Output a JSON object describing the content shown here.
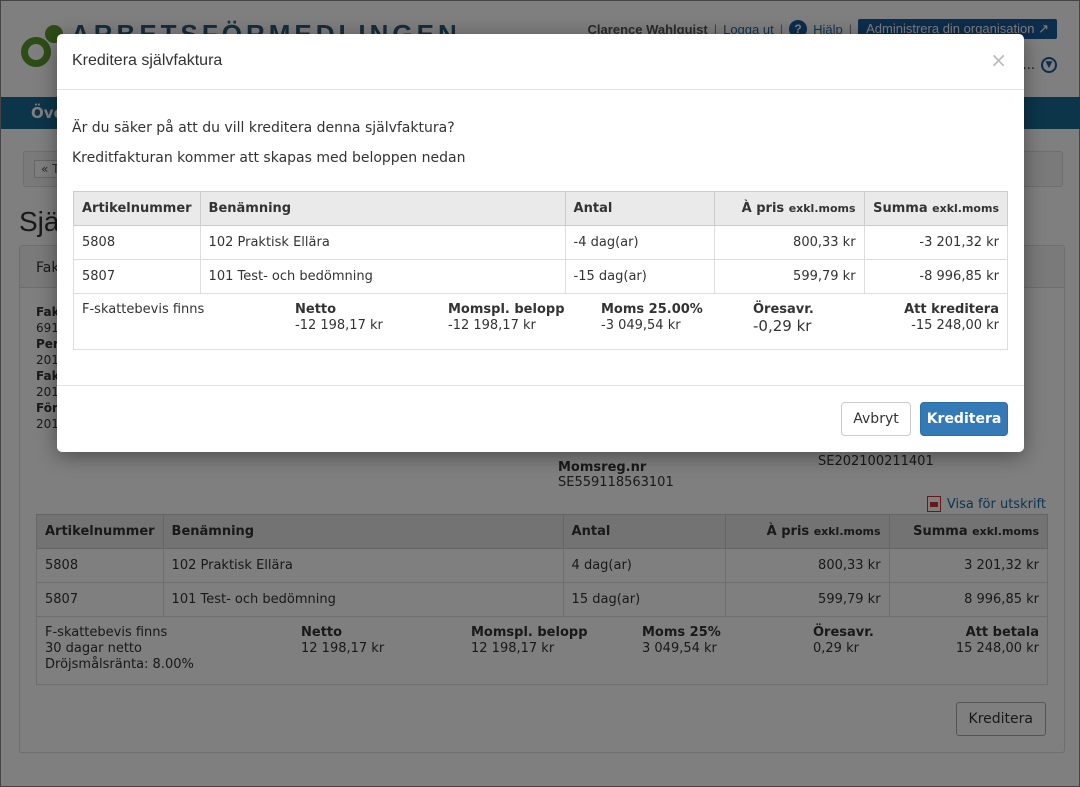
{
  "header": {
    "logo_text": "ARBETSFÖRMEDLINGEN",
    "user": "Clarence Wahlquist",
    "logout": "Logga ut",
    "help": "Hjälp",
    "admin": "Administrera din organisation"
  },
  "nav": {
    "first_item": "Öve"
  },
  "page": {
    "back_label": "« Ti",
    "title": "Sjä",
    "panel_tab": "Fak",
    "info_lines": [
      "Fak",
      "691",
      "Per",
      "201",
      "Fak",
      "201",
      "För",
      "201"
    ],
    "momsreg_label": "Momsreg.nr",
    "momsreg_value": "SE559118563101",
    "orgno": "SE202100211401",
    "print_link": "Visa för utskrift",
    "kreditera_button": "Kreditera"
  },
  "bg_table": {
    "headers": [
      "Artikelnummer",
      "Benämning",
      "Antal",
      "À pris",
      "Summa"
    ],
    "header_suffix": "exkl.moms",
    "rows": [
      [
        "5808",
        "102 Praktisk Ellära",
        "4 dag(ar)",
        "800,33 kr",
        "3 201,32 kr"
      ],
      [
        "5807",
        "101 Test- och bedömning",
        "15 dag(ar)",
        "599,79 kr",
        "8 996,85 kr"
      ]
    ],
    "summary": {
      "notes": [
        "F-skattebevis finns",
        "30 dagar netto",
        "Dröjsmålsränta: 8.00%"
      ],
      "netto_label": "Netto",
      "netto": "12 198,17 kr",
      "momspl_label": "Momspl. belopp",
      "momspl": "12 198,17 kr",
      "moms_label": "Moms 25%",
      "moms": "3 049,54 kr",
      "ores_label": "Öresavr.",
      "ores": "0,29 kr",
      "total_label": "Att betala",
      "total": "15 248,00 kr"
    }
  },
  "modal": {
    "title": "Kreditera självfaktura",
    "close": "×",
    "question": "Är du säker på att du vill kreditera denna självfaktura?",
    "info": "Kreditfakturan kommer att skapas med beloppen nedan",
    "table": {
      "headers": [
        "Artikelnummer",
        "Benämning",
        "Antal",
        "À pris",
        "Summa"
      ],
      "header_suffix": "exkl.moms",
      "rows": [
        [
          "5808",
          "102 Praktisk Ellära",
          "-4 dag(ar)",
          "800,33 kr",
          "-3 201,32 kr"
        ],
        [
          "5807",
          "101 Test- och bedömning",
          "-15 dag(ar)",
          "599,79 kr",
          "-8 996,85 kr"
        ]
      ],
      "summary": {
        "note": "F-skattebevis finns",
        "netto_label": "Netto",
        "netto": "-12 198,17 kr",
        "momspl_label": "Momspl. belopp",
        "momspl": "-12 198,17 kr",
        "moms_label": "Moms 25.00%",
        "moms": "-3 049,54 kr",
        "ores_label": "Öresavr.",
        "ores": "-0,29 kr",
        "total_label": "Att kreditera",
        "total": "-15 248,00 kr"
      }
    },
    "cancel": "Avbryt",
    "confirm": "Kreditera"
  }
}
